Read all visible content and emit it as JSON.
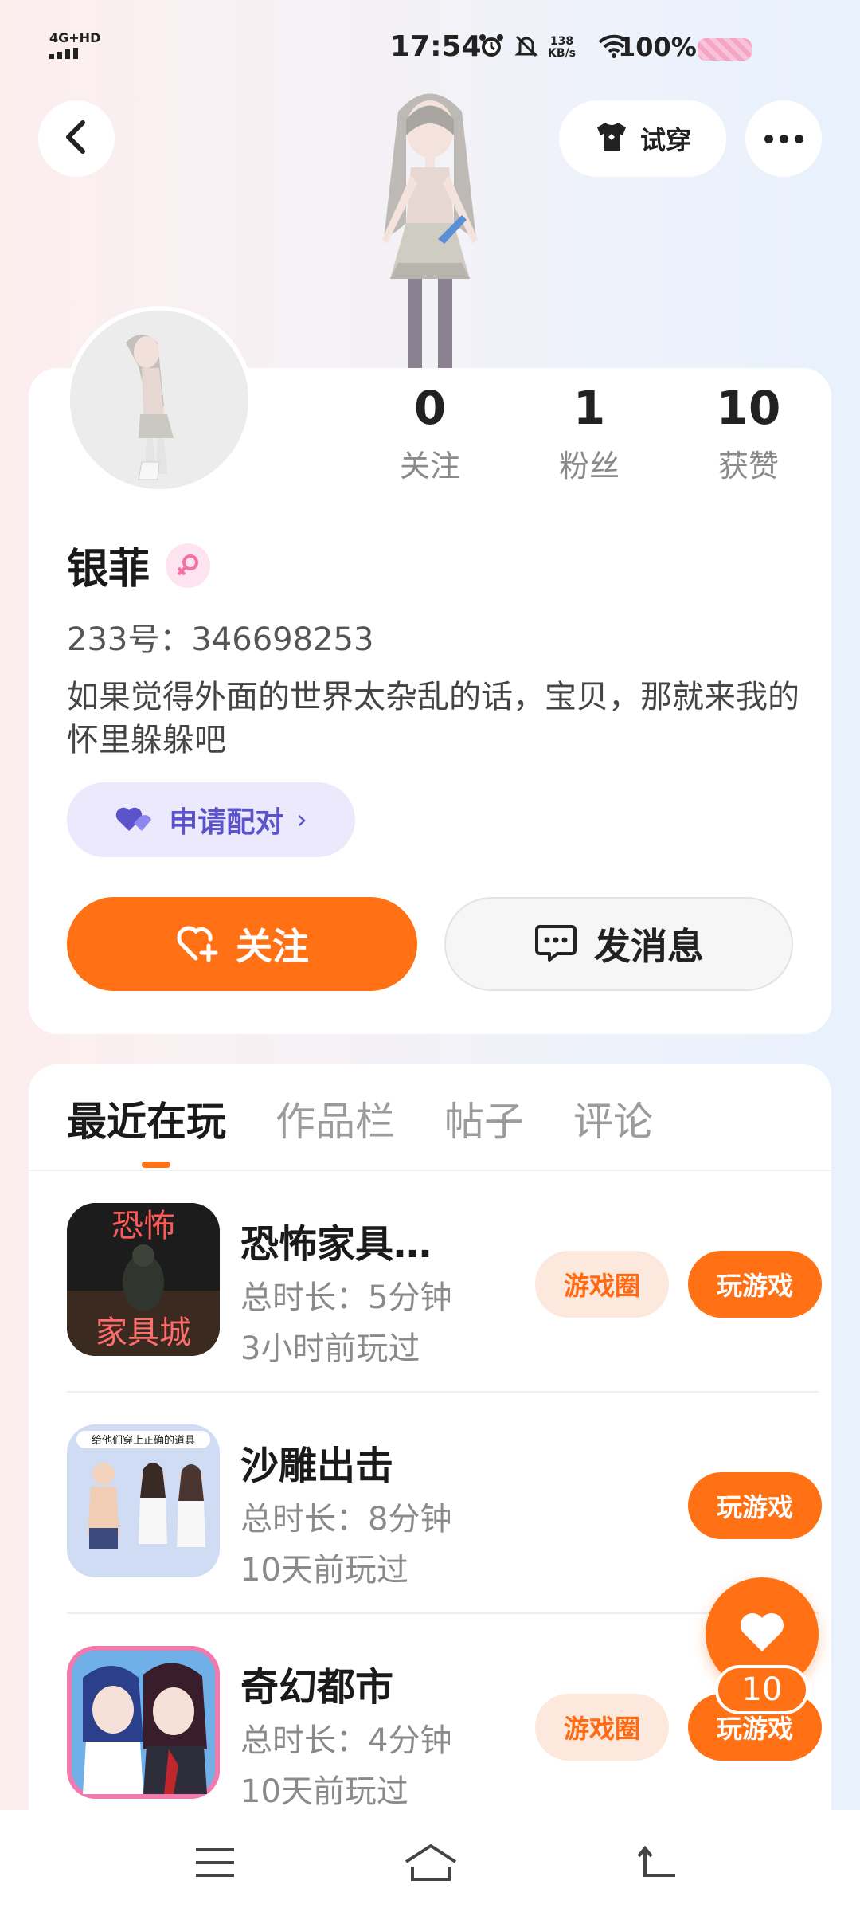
{
  "status_bar": {
    "network": "4G+HD",
    "time": "17:54",
    "speed_value": "138",
    "speed_unit": "KB/s",
    "battery": "100%"
  },
  "header": {
    "try_on_label": "试穿"
  },
  "profile": {
    "name": "银菲",
    "uid": "233号：346698253",
    "bio": "如果觉得外面的世界太杂乱的话，宝贝，那就来我的怀里躲躲吧",
    "stats": [
      {
        "value": "0",
        "label": "关注"
      },
      {
        "value": "1",
        "label": "粉丝"
      },
      {
        "value": "10",
        "label": "获赞"
      }
    ],
    "pair_label": "申请配对",
    "follow_label": "关注",
    "message_label": "发消息"
  },
  "tabs": [
    {
      "label": "最近在玩",
      "active": true
    },
    {
      "label": "作品栏",
      "active": false
    },
    {
      "label": "帖子",
      "active": false
    },
    {
      "label": "评论",
      "active": false
    }
  ],
  "games": [
    {
      "title": "恐怖家具…",
      "icon_text_top": "恐怖",
      "icon_text_bottom": "家具城",
      "total_time": "总时长：5分钟",
      "last_played": "3小时前玩过",
      "circle_label": "游戏圈",
      "play_label": "玩游戏"
    },
    {
      "title": "沙雕出击",
      "icon_text_top": "给他们穿上正确的道具",
      "total_time": "总时长：8分钟",
      "last_played": "10天前玩过",
      "play_label": "玩游戏"
    },
    {
      "title": "奇幻都市",
      "total_time": "总时长：4分钟",
      "last_played": "10天前玩过",
      "circle_label": "游戏圈",
      "play_label": "玩游戏"
    }
  ],
  "like_count": "10",
  "colors": {
    "accent": "#ff7114",
    "pair_purple": "#5b53c9",
    "gender_pink": "#f472a8"
  }
}
